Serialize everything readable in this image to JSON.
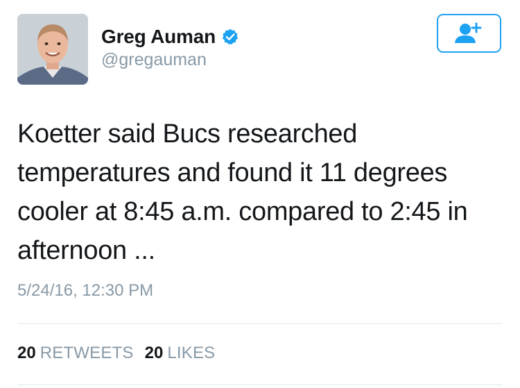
{
  "author": {
    "display_name": "Greg Auman",
    "handle": "@gregauman",
    "verified": true,
    "avatar_icon": "person-portrait"
  },
  "follow_button": {
    "icon": "add-user-icon",
    "color": "#1da1f2"
  },
  "tweet": {
    "text": "Koetter said Bucs researched temperatures and found it 11 degrees cooler at 8:45 a.m. compared to 2:45 in afternoon ...",
    "timestamp": "5/24/16, 12:30 PM"
  },
  "stats": {
    "retweets_count": "20",
    "retweets_label": "RETWEETS",
    "likes_count": "20",
    "likes_label": "LIKES"
  },
  "colors": {
    "accent": "#1da1f2",
    "secondary_text": "#8899a6",
    "primary_text": "#14171a",
    "divider": "#e1e8ed"
  }
}
